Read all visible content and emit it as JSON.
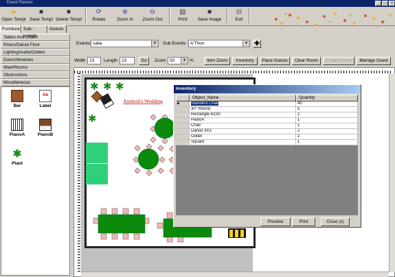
{
  "window": {
    "title": "Event Planner"
  },
  "toolbar": {
    "open": "Open Templ",
    "save": "Save Templ",
    "delete": "Delete Templ",
    "rotate": "Rotate",
    "zoom_in": "Zoom In",
    "zoom_out": "Zoom Out",
    "print": "Print",
    "save_image": "Save Image",
    "exit": "Exit"
  },
  "tabs": [
    "Furniture",
    "Sub-Events",
    "Guests"
  ],
  "categories": [
    "Tables And Chairs",
    "Risers/Dance Floor",
    "Lighting/Audio/Outlets",
    "Doors/Windows",
    "WashRooms",
    "Obstructions",
    "Miscellaneous"
  ],
  "items": {
    "bar": "Bar",
    "label": "Label",
    "pianoa": "PianoA",
    "pianob": "PianoB",
    "plant": "Plant"
  },
  "events": {
    "label": "Events:",
    "value": "saila",
    "sub_label": "Sub Events :",
    "sub_value": "A'Thon"
  },
  "controls": {
    "width_label": "Width",
    "width": "23",
    "length_label": "Length",
    "length": "23",
    "go": "Go",
    "zoom_label": "Zoom",
    "zoom": "50",
    "zoom_unit": "%",
    "item_zoom": "Item Zoom",
    "inventory": "Inventory",
    "place_guests": "Place Guests",
    "clear_room": "Clear Room",
    "create_room": "Create Room",
    "manage_guest": "Manage Guest"
  },
  "canvas": {
    "wedding_label": "Anulesh's Wedding"
  },
  "inventory": {
    "title": "Inventory",
    "col_name": "Object_Name",
    "col_qty": "Quantity",
    "rows": [
      {
        "name": "Standerd Chair",
        "qty": "40"
      },
      {
        "name": "30\" Round",
        "qty": "5"
      },
      {
        "name": "Rectangle 6X30",
        "qty": "2"
      },
      {
        "name": "PianoA",
        "qty": "1"
      },
      {
        "name": "Chair",
        "qty": "1"
      },
      {
        "name": "Dance 3X3",
        "qty": "2"
      },
      {
        "name": "Outlet",
        "qty": "2"
      },
      {
        "name": "Square",
        "qty": "1"
      }
    ],
    "preview": "Preview",
    "print": "Print",
    "close": "Close (x)"
  },
  "colors": {
    "title_bar": "#0a246a",
    "table_green": "#0c8a0c",
    "chair_pink": "#f3b6b6",
    "dance_floor": "#2fd07a"
  }
}
